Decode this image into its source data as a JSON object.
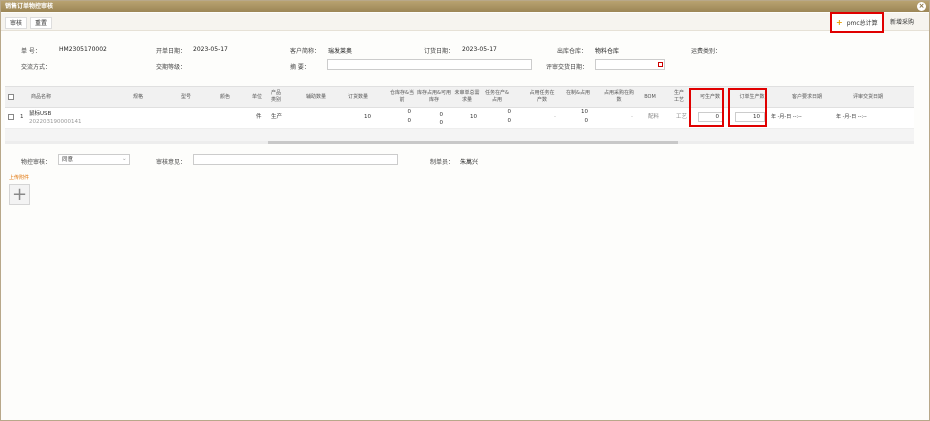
{
  "window": {
    "title": "销售订单物控审核"
  },
  "toolbar": {
    "approve": "审核",
    "reset": "重置",
    "pmc_calc": "pmc总计算",
    "new_purchase": "新增采购"
  },
  "form": {
    "order_no_label": "单 号：",
    "order_no": "HM2305170002",
    "open_date_label": "开单日期：",
    "open_date": "2023-05-17",
    "customer_label": "客户简称：",
    "customer": "瑞发莱奥",
    "order_date_label": "订货日期：",
    "order_date": "2023-05-17",
    "warehouse_label": "出库仓库：",
    "warehouse": "物料仓库",
    "ship_type_label": "运费类别：",
    "trade_mode_label": "交流方式：",
    "delivery_level_label": "交期等级：",
    "summary_label": "摘 要：",
    "review_date_label": "评审交货日期："
  },
  "grid": {
    "headers": [
      "商品名称",
      "规格",
      "型号",
      "颜色",
      "单位",
      "产品类别",
      "辅助数量",
      "订货数量",
      "仓库存&当前",
      "库存占用&可用库存",
      "未审单总需求量",
      "任务在产&占用",
      "占用任务在产数",
      "在制&占用",
      "占用采购在购数",
      "BOM",
      "生产工艺",
      "可生产数",
      "订单生产数",
      "客户要求日期",
      "评审交货日期"
    ],
    "rows": [
      {
        "index": "1",
        "name": "鼠标USB",
        "code": "202203190000141",
        "unit": "件",
        "category": "生产",
        "order_qty": "10",
        "stock_a": "0",
        "stock_b": "0",
        "occ_a": "0",
        "occ_b": "0",
        "pending": "10",
        "task_a": "0",
        "task_b": "0",
        "occ_task": "-",
        "wip_a": "10",
        "wip_b": "0",
        "occ_purchase": "-",
        "bom": "配料",
        "process": "工艺",
        "producible": "0",
        "order_produce": "10",
        "cust_date": "年 -月-日 --:--",
        "review_date": "年 -月-日 --:--"
      }
    ]
  },
  "bottom": {
    "material_review_label": "物控审核：",
    "material_review_value": "同意",
    "review_opinion_label": "审核意见：",
    "maker_label": "制单员：",
    "maker": "朱萬兴",
    "upload_label": "上传附件"
  }
}
